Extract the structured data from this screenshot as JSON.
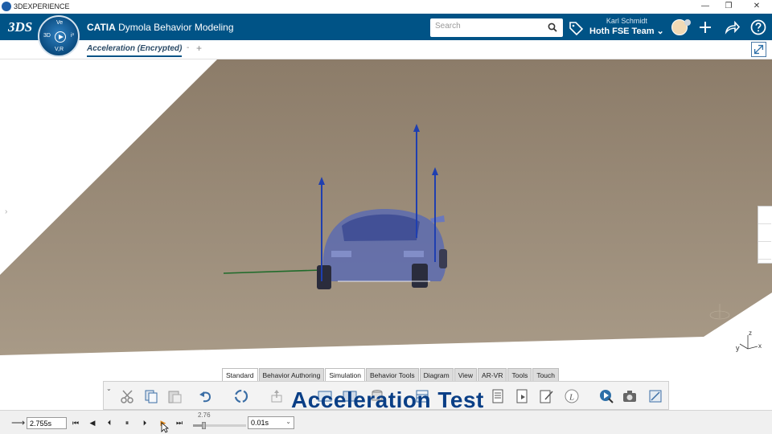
{
  "window": {
    "app_name": "3DEXPERIENCE",
    "minimize_glyph": "—",
    "restore_glyph": "❐",
    "close_glyph": "✕"
  },
  "header": {
    "logo_text": "3DS",
    "compass": {
      "top": "Ve",
      "left": "3D",
      "right": "i³",
      "bottom": "V,R"
    },
    "brand_name": "CATIA",
    "app_title": "Dymola Behavior Modeling",
    "search_placeholder": "Search",
    "user_name": "Karl Schmidt",
    "team": "Hoth FSE Team ⌄"
  },
  "tabs": {
    "active_tab": "Acceleration (Encrypted)",
    "dash": "-",
    "add": "+"
  },
  "viewport": {
    "side_arrow": "›",
    "axis_x": "x",
    "axis_y": "y",
    "axis_z": "z"
  },
  "toolbar": {
    "collapse": "⌄",
    "sections": [
      "Standard",
      "Behavior Authoring",
      "Simulation",
      "Behavior Tools",
      "Diagram",
      "View",
      "AR-VR",
      "Tools",
      "Touch"
    ],
    "active_section": "Standard",
    "selected_section": "Simulation"
  },
  "overlay": {
    "title": "Acceleration Test"
  },
  "playback": {
    "direction_glyph": "⟶",
    "current_time": "2.755s",
    "slider_value": "2.76",
    "slider_fraction": 0.2,
    "time_step": "0.01s",
    "time_step_chevron": "⌄",
    "buttons": {
      "first": "⏮",
      "prev": "◀",
      "step_back": "⏴",
      "pause": "⏸",
      "step_fwd": "⏵",
      "play": "▶",
      "last": "⏭"
    }
  },
  "colors": {
    "topbar": "#005386",
    "ground": "#8f8170",
    "vector": "#1f3fb0",
    "car": "#5c6bb0",
    "overlay_text": "#0a3f86"
  }
}
